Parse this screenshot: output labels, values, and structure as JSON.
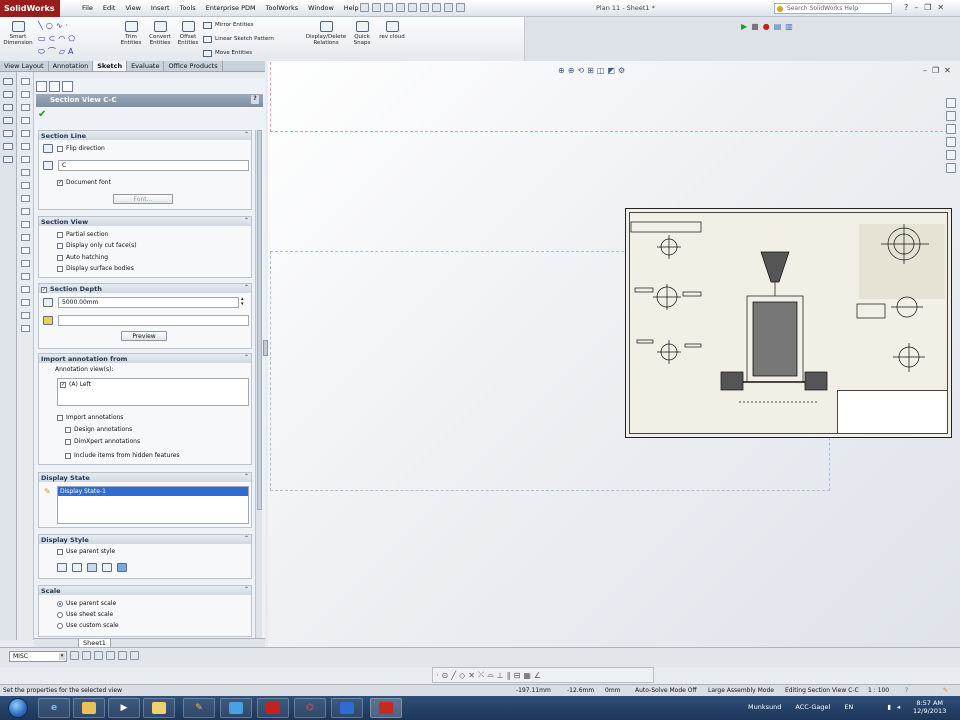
{
  "app": {
    "name": "SolidWorks",
    "doc_title": "Plan 11 - Sheet1 *"
  },
  "menu": [
    "File",
    "Edit",
    "View",
    "Insert",
    "Tools",
    "Enterprise PDM",
    "ToolWorks",
    "Window",
    "Help"
  ],
  "search": {
    "placeholder": "Search SolidWorks Help"
  },
  "command_manager": {
    "smart_dimension": "Smart Dimension",
    "trim": "Trim Entities",
    "convert": "Convert Entities",
    "offset": "Offset Entities",
    "mirror": "Mirror Entities",
    "linear_pattern": "Linear Sketch Pattern",
    "move": "Move Entities",
    "display_delete": "Display/Delete Relations",
    "quick_snaps": "Quick Snaps",
    "rev_cloud": "rev cloud"
  },
  "tabs": [
    {
      "label": "View Layout",
      "active": false
    },
    {
      "label": "Annotation",
      "active": false
    },
    {
      "label": "Sketch",
      "active": true
    },
    {
      "label": "Evaluate",
      "active": false
    },
    {
      "label": "Office Products",
      "active": false
    }
  ],
  "property_manager": {
    "title": "Section View C-C",
    "section_line": {
      "title": "Section Line",
      "flip_direction": "Flip direction",
      "label_value": "C",
      "document_font": "Document font",
      "font_button": "Font..."
    },
    "section_view": {
      "title": "Section View",
      "partial_section": "Partial section",
      "display_cut_faces": "Display only cut face(s)",
      "auto_hatching": "Auto hatching",
      "display_surface_bodies": "Display surface bodies"
    },
    "section_depth": {
      "title": "Section Depth",
      "value": "5000.00mm",
      "preview_button": "Preview"
    },
    "import_annotation": {
      "title": "Import annotation from",
      "views_label": "Annotation view(s):",
      "view_item": "(A) Left",
      "import_annotations": "Import annotations",
      "design_annotations": "Design annotations",
      "dimxpert_annotations": "DimXpert annotations",
      "include_hidden": "Include items from hidden features"
    },
    "display_state": {
      "title": "Display State",
      "item": "Display State-1"
    },
    "display_style": {
      "title": "Display Style",
      "use_parent": "Use parent style"
    },
    "scale": {
      "title": "Scale",
      "parent": "Use parent scale",
      "sheet": "Use sheet scale",
      "custom": "Use custom scale"
    }
  },
  "sheet_tab": "Sheet1",
  "bottom_select": "MISC",
  "status": {
    "message": "Set the properties for the selected view",
    "x": "-197.11mm",
    "y": "-12.6mm",
    "z": "0mm",
    "autosolve": "Auto-Solve Mode Off",
    "assembly_mode": "Large Assembly Mode",
    "editing": "Editing Section View C-C",
    "scale": "1 : 100"
  },
  "taskbar": {
    "user": "Munksund",
    "app": "ACC-Gagel",
    "lang": "EN",
    "time": "8:57 AM",
    "date": "12/9/2013"
  },
  "colors": {
    "titlebar_accent": "#9b1c1c",
    "pm_header": "#8797aa",
    "selection": "#2f6bd1",
    "check_green": "#1b9a2b"
  }
}
